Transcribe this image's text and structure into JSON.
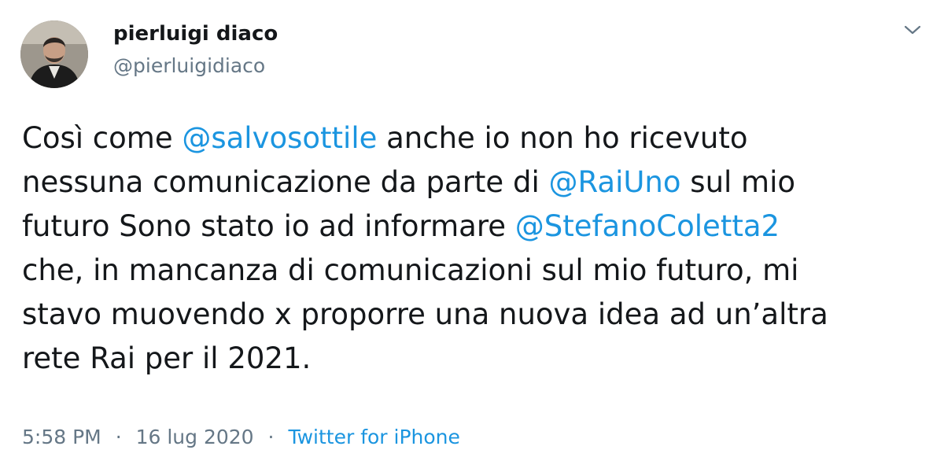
{
  "author": {
    "name": "pierluigi diaco",
    "handle": "@pierluigidiaco"
  },
  "menu_icon": "chevron-down-icon",
  "tweet": {
    "lines": [
      [
        {
          "text": "Così come "
        },
        {
          "text": "@salvosottile",
          "mention": true
        },
        {
          "text": " anche io non ho ricevuto"
        }
      ],
      [
        {
          "text": "nessuna comunicazione da parte di "
        },
        {
          "text": "@RaiUno",
          "mention": true
        },
        {
          "text": " sul mio"
        }
      ],
      [
        {
          "text": "futuro Sono stato io ad informare "
        },
        {
          "text": "@StefanoColetta2",
          "mention": true
        }
      ],
      [
        {
          "text": "che, in mancanza di comunicazioni sul mio futuro, mi"
        }
      ],
      [
        {
          "text": "stavo muovendo x proporre una nuova idea ad un’altra"
        }
      ],
      [
        {
          "text": "rete Rai per il 2021."
        }
      ]
    ]
  },
  "meta": {
    "time": "5:58 PM",
    "separator": "·",
    "date": "16 lug 2020",
    "source": "Twitter for iPhone"
  },
  "colors": {
    "text": "#14171a",
    "secondary": "#657786",
    "link": "#1b95e0",
    "background": "#ffffff"
  }
}
